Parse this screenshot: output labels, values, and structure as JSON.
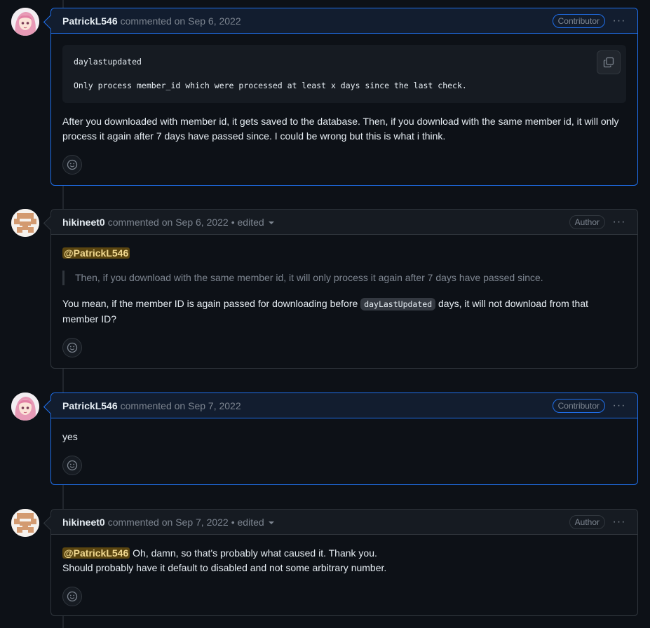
{
  "comments": [
    {
      "author": "PatrickL546",
      "meta": "commented on Sep 6, 2022",
      "badge": "Contributor",
      "code_line1": "daylastupdated",
      "code_line2": "Only process member_id which were processed at least x days since the last check.",
      "text": "After you downloaded with member id, it gets saved to the database. Then, if you download with the same member id, it will only process it again after 7 days have passed since. I could be wrong but this is what i think."
    },
    {
      "author": "hikineet0",
      "meta": "commented on Sep 6, 2022",
      "edited": "• edited",
      "badge": "Author",
      "mention": "@PatrickL546",
      "quote": "Then, if you download with the same member id, it will only process it again after 7 days have passed since.",
      "text_before": "You mean, if the member ID is again passed for downloading before ",
      "code": "dayLastUpdated",
      "text_after": " days, it will not download from that member ID?"
    },
    {
      "author": "PatrickL546",
      "meta": "commented on Sep 7, 2022",
      "badge": "Contributor",
      "text": "yes"
    },
    {
      "author": "hikineet0",
      "meta": "commented on Sep 7, 2022",
      "edited": "• edited",
      "badge": "Author",
      "mention": "@PatrickL546",
      "line1": " Oh, damn, so that's probably what caused it. Thank you.",
      "line2": "Should probably have it default to disabled and not some arbitrary number."
    }
  ],
  "kebab": "···",
  "colors": {
    "background": "#0d1117",
    "contributor_border": "#1f6feb",
    "mention_bg": "#5a4510"
  },
  "icons": [
    "avatar-anime-icon",
    "avatar-identicon-icon",
    "copy-icon",
    "smiley-icon",
    "kebab-icon",
    "caret-down-icon"
  ]
}
